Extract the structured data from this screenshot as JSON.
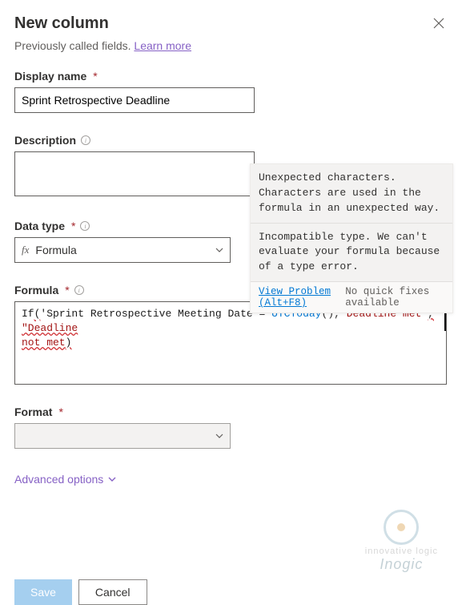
{
  "dialog": {
    "title": "New column",
    "subtitle_prefix": "Previously called fields. ",
    "learn_more": "Learn more"
  },
  "fields": {
    "display_name": {
      "label": "Display name",
      "value": "Sprint Retrospective Deadline"
    },
    "description": {
      "label": "Description",
      "value": ""
    },
    "data_type": {
      "label": "Data type",
      "value": "Formula",
      "prefix": "fx"
    },
    "formula": {
      "label": "Formula",
      "tokens": {
        "fn": "If",
        "paren_open": "(",
        "field": "'Sprint Retrospective Meeting Date'",
        "op": "= ",
        "call": "UTCToday",
        "args": "()",
        "comma1": ",",
        "str1": "\"Deadline met\"",
        "comma2": ", ",
        "str2_a": "\"Deadline",
        "str2_b": "not met",
        "paren_close": ")"
      }
    },
    "format": {
      "label": "Format"
    }
  },
  "tooltip": {
    "msg1": "Unexpected characters. Characters are used in the formula in an unexpected way.",
    "msg2": "Incompatible type. We can't evaluate your formula because of a type error.",
    "view_problem": "View Problem (Alt+F8)",
    "no_fixes": "No quick fixes available"
  },
  "advanced": {
    "label": "Advanced options"
  },
  "buttons": {
    "save": "Save",
    "cancel": "Cancel"
  },
  "logo": {
    "tagline": "innovative logic",
    "brand": "Inogic"
  }
}
